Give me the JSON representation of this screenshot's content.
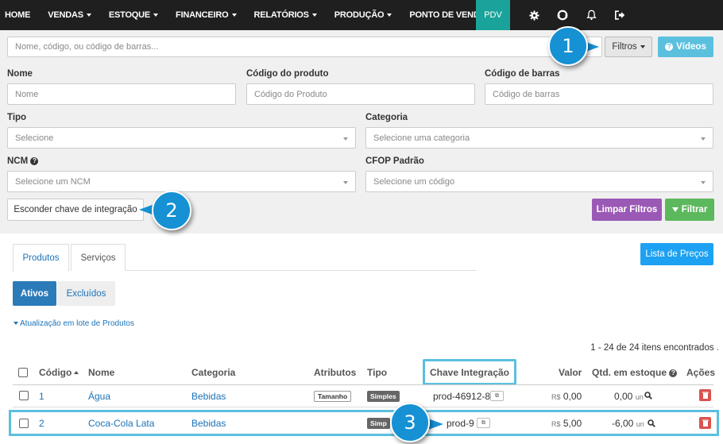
{
  "nav": {
    "items": [
      "HOME",
      "VENDAS",
      "ESTOQUE",
      "FINANCEIRO",
      "RELATÓRIOS",
      "PRODUÇÃO",
      "PONTO DE VENDA"
    ],
    "pdv": "PDV"
  },
  "search": {
    "placeholder": "Nome, código, ou código de barras..."
  },
  "buttons": {
    "filtros": "Filtros",
    "videos": "Vídeos",
    "esconder": "Esconder chave de integração",
    "limpar": "Limpar Filtros",
    "filtrar": "Filtrar",
    "lista_precos": "Lista de Preços"
  },
  "filters": {
    "nome_label": "Nome",
    "nome_placeholder": "Nome",
    "codigo_label": "Código do produto",
    "codigo_placeholder": "Código do Produto",
    "barras_label": "Código de barras",
    "barras_placeholder": "Código de barras",
    "tipo_label": "Tipo",
    "tipo_value": "Selecione",
    "categoria_label": "Categoria",
    "categoria_value": "Selecione uma categoria",
    "ncm_label": "NCM",
    "ncm_value": "Selecione um NCM",
    "cfop_label": "CFOP Padrão",
    "cfop_value": "Selecione um código"
  },
  "callouts": [
    "1",
    "2",
    "3"
  ],
  "tabs": {
    "produtos": "Produtos",
    "servicos": "Serviços",
    "ativos": "Ativos",
    "excluidos": "Excluídos"
  },
  "bulk_link": "Atualização em lote de Produtos",
  "count": "1 - 24 de 24 itens encontrados",
  "count_dot": ".",
  "table": {
    "headers": {
      "codigo": "Código",
      "nome": "Nome",
      "categoria": "Categoria",
      "atributos": "Atributos",
      "tipo": "Tipo",
      "chave": "Chave Integração",
      "valor": "Valor",
      "qtd": "Qtd. em estoque",
      "acoes": "Ações"
    },
    "rows": [
      {
        "codigo": "1",
        "nome": "Água",
        "categoria": "Bebidas",
        "atributo": "Tamanho",
        "tipo": "Simples",
        "chave": "prod-46912-8",
        "moeda": "R$",
        "valor": "0,00",
        "qtd": "0,00",
        "unidade": "un"
      },
      {
        "codigo": "2",
        "nome": "Coca-Cola Lata",
        "categoria": "Bebidas",
        "atributo": "",
        "tipo": "Simp",
        "chave": "prod-9",
        "moeda": "R$",
        "valor": "5,00",
        "qtd": "-6,00",
        "unidade": "un"
      }
    ]
  },
  "colors": {
    "nav": "#1f1f1f",
    "pdv": "#1aa39a",
    "callout": "#1591d4",
    "highlight": "#5bc0de"
  }
}
